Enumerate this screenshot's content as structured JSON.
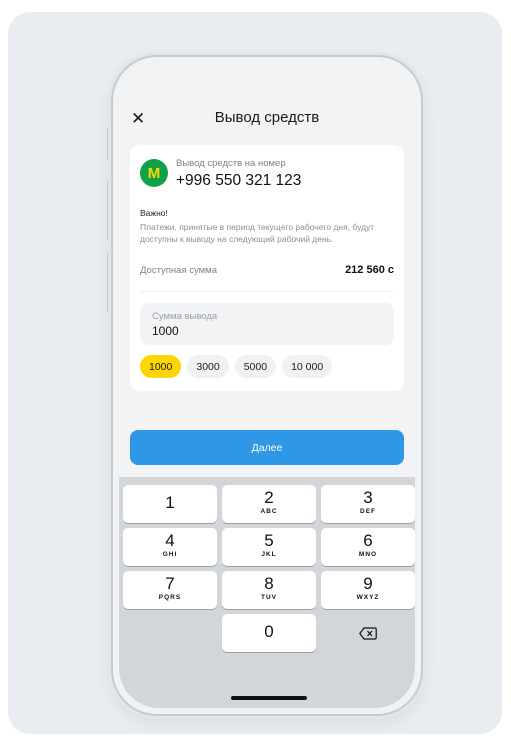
{
  "header": {
    "close_icon": "close-icon",
    "title": "Вывод средств"
  },
  "account": {
    "logo_letter": "M",
    "label": "Вывод средств на номер",
    "phone": "+996 550 321 123"
  },
  "notice": {
    "title": "Важно!",
    "text": "Платежи, принятые в период текущего рабочего дня, будут доступны к выводу на следующий рабочий день."
  },
  "balance": {
    "label": "Доступная сумма",
    "value": "212 560 с"
  },
  "amount": {
    "label": "Сумма вывода",
    "value": "1000"
  },
  "chips": [
    {
      "label": "1000",
      "active": true
    },
    {
      "label": "3000",
      "active": false
    },
    {
      "label": "5000",
      "active": false
    },
    {
      "label": "10 000",
      "active": false
    }
  ],
  "next_button": {
    "label": "Далее"
  },
  "keypad": {
    "keys": [
      {
        "digit": "1",
        "letters": ""
      },
      {
        "digit": "2",
        "letters": "ABC"
      },
      {
        "digit": "3",
        "letters": "DEF"
      },
      {
        "digit": "4",
        "letters": "GHI"
      },
      {
        "digit": "5",
        "letters": "JKL"
      },
      {
        "digit": "6",
        "letters": "MNO"
      },
      {
        "digit": "7",
        "letters": "PQRS"
      },
      {
        "digit": "8",
        "letters": "TUV"
      },
      {
        "digit": "9",
        "letters": "WXYZ"
      },
      {
        "digit": "0",
        "letters": ""
      }
    ],
    "backspace_icon": "backspace-icon"
  },
  "colors": {
    "accent": "#2e97e6",
    "chip_active": "#ffd600",
    "logo_green": "#13a04a"
  }
}
